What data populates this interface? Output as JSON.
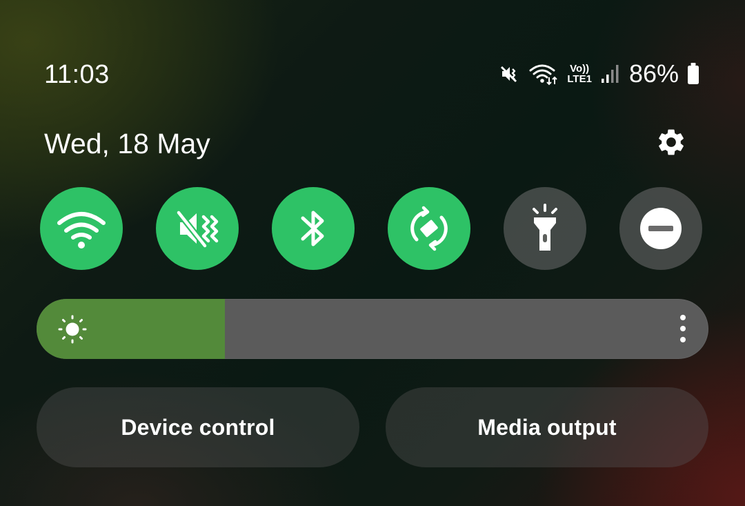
{
  "status_bar": {
    "time": "11:03",
    "volte_top": "Vo))",
    "volte_bottom": "LTE1",
    "battery_percent": "86%",
    "icons": [
      "mute-vibrate-icon",
      "wifi-data-icon",
      "volte-icon",
      "signal-icon",
      "battery-icon"
    ]
  },
  "header": {
    "date": "Wed, 18 May",
    "settings_icon": "gear-icon"
  },
  "quick_tiles": [
    {
      "name": "wifi",
      "icon": "wifi-icon",
      "active": true
    },
    {
      "name": "sound",
      "icon": "mute-vibrate-icon",
      "active": true
    },
    {
      "name": "bluetooth",
      "icon": "bluetooth-icon",
      "active": true
    },
    {
      "name": "auto-rotate",
      "icon": "auto-rotate-icon",
      "active": true
    },
    {
      "name": "flashlight",
      "icon": "flashlight-icon",
      "active": false
    },
    {
      "name": "do-not-disturb",
      "icon": "do-not-disturb-icon",
      "active": false
    }
  ],
  "brightness": {
    "level": 0.28,
    "icon": "sun-icon",
    "menu_icon": "more-vertical-icon"
  },
  "buttons": {
    "device_control": "Device control",
    "media_output": "Media output"
  },
  "colors": {
    "tile_active": "#2ec266",
    "brightness_fill": "#538a3a"
  }
}
